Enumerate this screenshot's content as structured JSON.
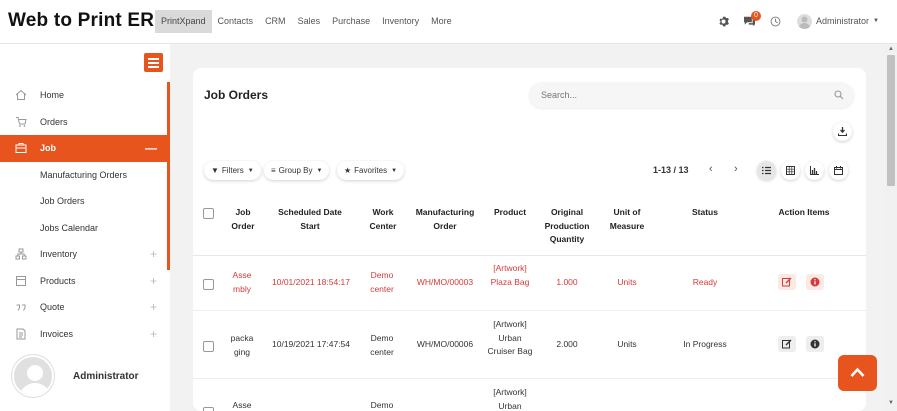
{
  "app": {
    "brand": "Web to Print ERP"
  },
  "top_menu": [
    "PrintXpand",
    "Contacts",
    "CRM",
    "Sales",
    "Purchase",
    "Inventory",
    "More"
  ],
  "top_right": {
    "notification_count": "0",
    "user_name": "Administrator"
  },
  "sidebar": {
    "items": [
      {
        "label": "Home",
        "icon": "home-icon"
      },
      {
        "label": "Orders",
        "icon": "cart-icon"
      },
      {
        "label": "Job",
        "icon": "job-icon",
        "toggle": "—"
      },
      {
        "label": "Inventory",
        "icon": "inventory-icon",
        "toggle": "+"
      },
      {
        "label": "Products",
        "icon": "products-icon",
        "toggle": "+"
      },
      {
        "label": "Quote",
        "icon": "quote-icon",
        "toggle": "+"
      },
      {
        "label": "Invoices",
        "icon": "invoice-icon",
        "toggle": "+"
      }
    ],
    "job_subitems": [
      "Manufacturing Orders",
      "Job Orders",
      "Jobs Calendar"
    ],
    "user": "Administrator"
  },
  "main": {
    "title": "Job Orders",
    "search_placeholder": "Search...",
    "filters": {
      "filters": "Filters",
      "group_by": "Group By",
      "favorites": "Favorites"
    },
    "pager": "1-13 / 13",
    "columns": [
      "Job Order",
      "Scheduled Date Start",
      "Work Center",
      "Manufacturing Order",
      "Product",
      "Original Production Quantity",
      "Unit of Measure",
      "Status",
      "Action Items"
    ],
    "rows": [
      {
        "job_order": "Asse mbly",
        "date": "10/01/2021 18:54:17",
        "work_center": "Demo center",
        "mo": "WH/MO/00003",
        "product": "[Artwork] Plaza Bag",
        "qty": "1.000",
        "uom": "Units",
        "status": "Ready"
      },
      {
        "job_order": "packa ging",
        "date": "10/19/2021 17:47:54",
        "work_center": "Demo center",
        "mo": "WH/MO/00006",
        "product": "[Artwork] Urban Cruiser Bag",
        "qty": "2.000",
        "uom": "Units",
        "status": "In Progress"
      },
      {
        "job_order": "Asse",
        "date": "",
        "work_center": "Demo",
        "mo": "",
        "product": "[Artwork] Urban",
        "qty": "",
        "uom": "",
        "status": ""
      }
    ]
  },
  "colors": {
    "accent": "#e8541e",
    "link_red": "#d43a3a"
  }
}
